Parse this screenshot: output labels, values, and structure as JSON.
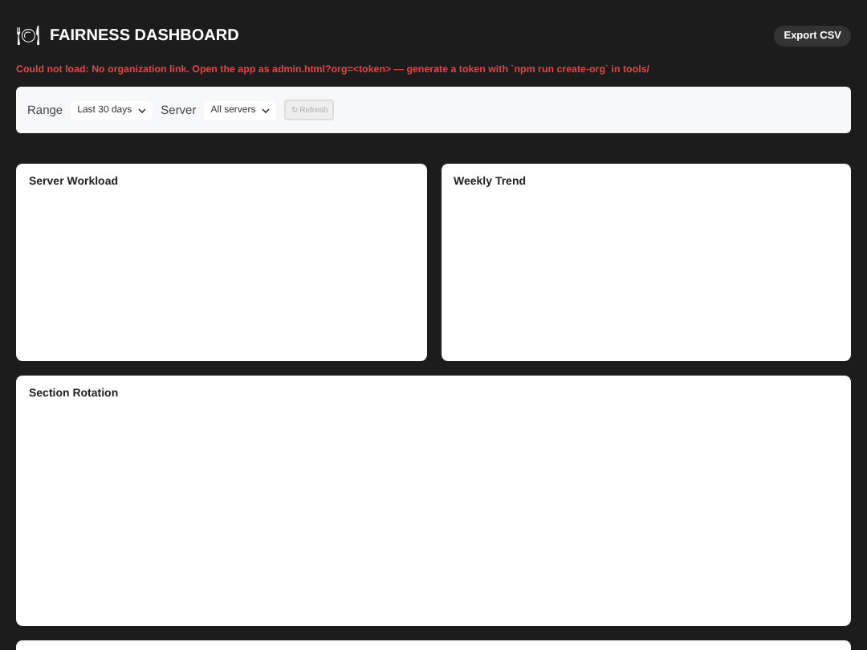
{
  "header": {
    "icon": "🍽",
    "title": "FAIRNESS DASHBOARD",
    "export_button": "Export CSV"
  },
  "error": "Could not load: No organization link. Open the app as admin.html?org=<token> — generate a token with `npm run create-org` in tools/",
  "filters": {
    "range_label": "Range",
    "range_value": "Last 30 days",
    "server_label": "Server",
    "server_value": "All servers",
    "refresh": {
      "label": "↻ Refresh",
      "disabled": true
    }
  },
  "panels": [
    {
      "title": "Server Workload",
      "wide": false
    },
    {
      "title": "Weekly Trend",
      "wide": false
    },
    {
      "title": "Section Rotation",
      "wide": true
    },
    {
      "wide": true
    }
  ]
}
